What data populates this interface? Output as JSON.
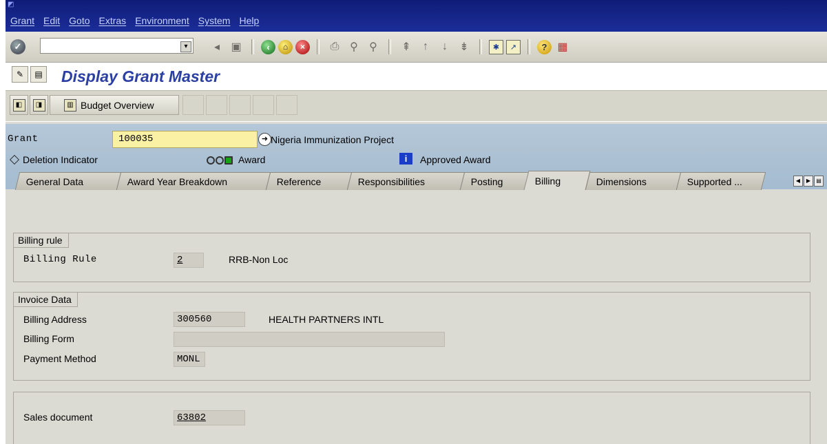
{
  "menu": [
    "Grant",
    "Edit",
    "Goto",
    "Extras",
    "Environment",
    "System",
    "Help"
  ],
  "title": "Display Grant Master",
  "app_toolbar": {
    "budget_overview": "Budget Overview"
  },
  "header": {
    "grant_label": "Grant",
    "grant_value": "100035",
    "grant_description": "Nigeria Immunization Project",
    "deletion_indicator": "Deletion Indicator",
    "award_label": "Award",
    "approved_award": "Approved Award"
  },
  "tabs": [
    "General Data",
    "Award Year Breakdown",
    "Reference",
    "Responsibilities",
    "Posting",
    "Billing",
    "Dimensions",
    "Supported ..."
  ],
  "active_tab": "Billing",
  "billing_rule_group": {
    "title": "Billing rule",
    "label": "Billing Rule",
    "value": "2",
    "description": "RRB-Non Loc"
  },
  "invoice_group": {
    "title": "Invoice Data",
    "billing_address_label": "Billing Address",
    "billing_address_value": "300560",
    "billing_address_desc": "HEALTH PARTNERS INTL",
    "billing_form_label": "Billing Form",
    "billing_form_value": "",
    "payment_method_label": "Payment Method",
    "payment_method_value": "MONL"
  },
  "sales_group": {
    "label": "Sales document",
    "value": "63802"
  },
  "colors": {
    "menubar": "#1b2d99",
    "title": "#2c40a4",
    "header": "#a5bbcf",
    "grant_field": "#fbf1a4",
    "background": "#dcdbd3"
  }
}
